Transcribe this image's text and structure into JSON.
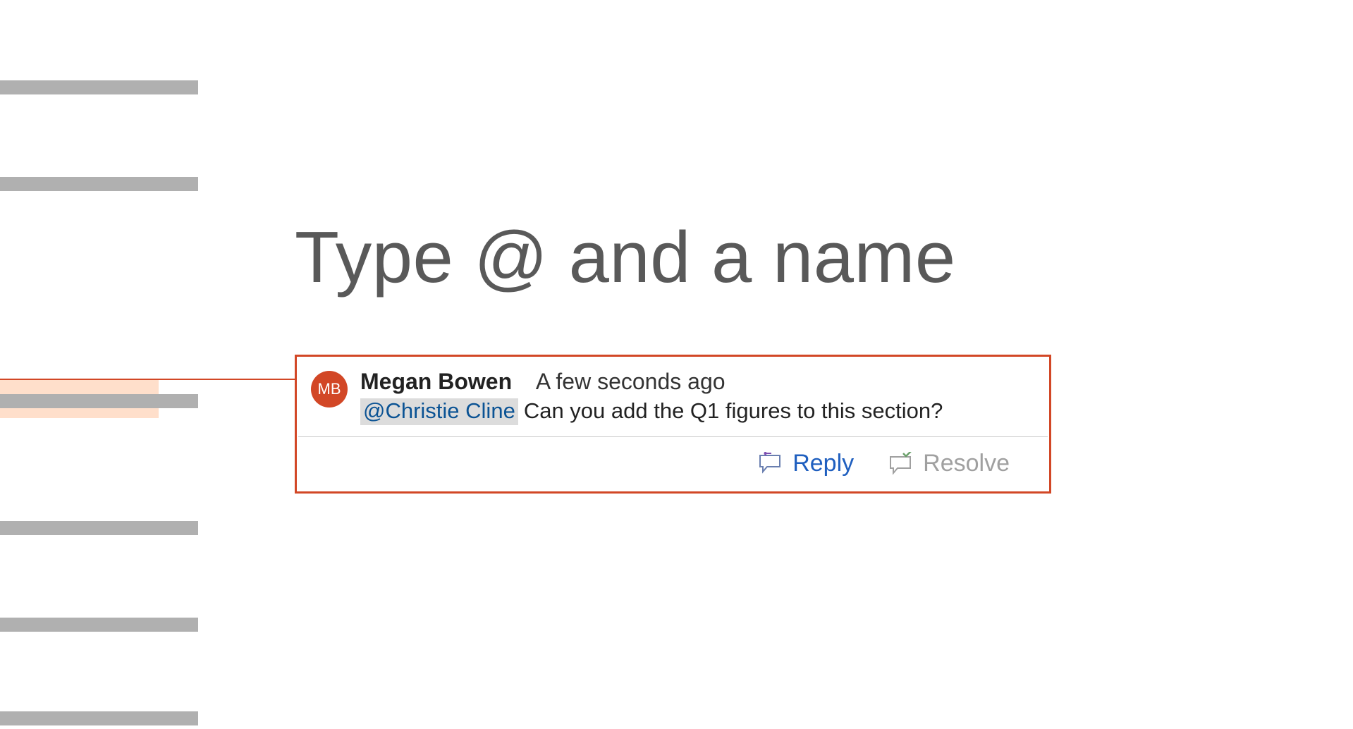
{
  "heading": "Type @ and a name",
  "comment": {
    "avatar_initials": "MB",
    "author": "Megan Bowen",
    "timestamp": "A few seconds ago",
    "mention": "@Christie Cline",
    "body": "Can you add the Q1 figures to this section?"
  },
  "buttons": {
    "reply": "Reply",
    "resolve": "Resolve"
  }
}
